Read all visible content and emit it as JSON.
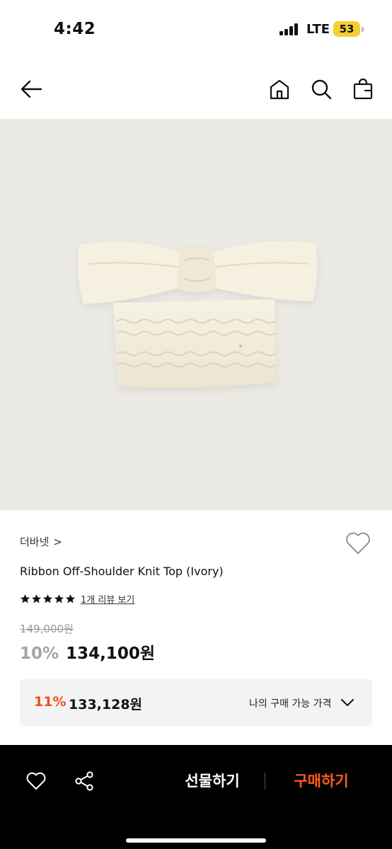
{
  "status_bar": {
    "time": "4:42",
    "network": "LTE",
    "battery": "53"
  },
  "nav": {
    "back_icon": "arrow-left-icon",
    "home_icon": "home-icon",
    "search_icon": "search-icon",
    "bag_icon": "shopping-bag-icon"
  },
  "product": {
    "brand": "더바넷",
    "brand_chevron": ">",
    "title": "Ribbon Off-Shoulder Knit Top (Ivory)",
    "rating_stars": 5,
    "review_link": "1개 리뷰 보기",
    "original_price": "149,000원",
    "discount_rate": "10%",
    "sale_price": "134,100원"
  },
  "buy_price": {
    "rate": "11%",
    "price": "133,128원",
    "label": "나의 구매 가능 가격"
  },
  "bottom_bar": {
    "gift_label": "선물하기",
    "purchase_label": "구매하기"
  },
  "colors": {
    "accent": "#f04e18",
    "purchase": "#ff5a1f",
    "image_bg": "#ebeae4",
    "knit": "#f4efdf",
    "battery": "#f4cf31"
  }
}
